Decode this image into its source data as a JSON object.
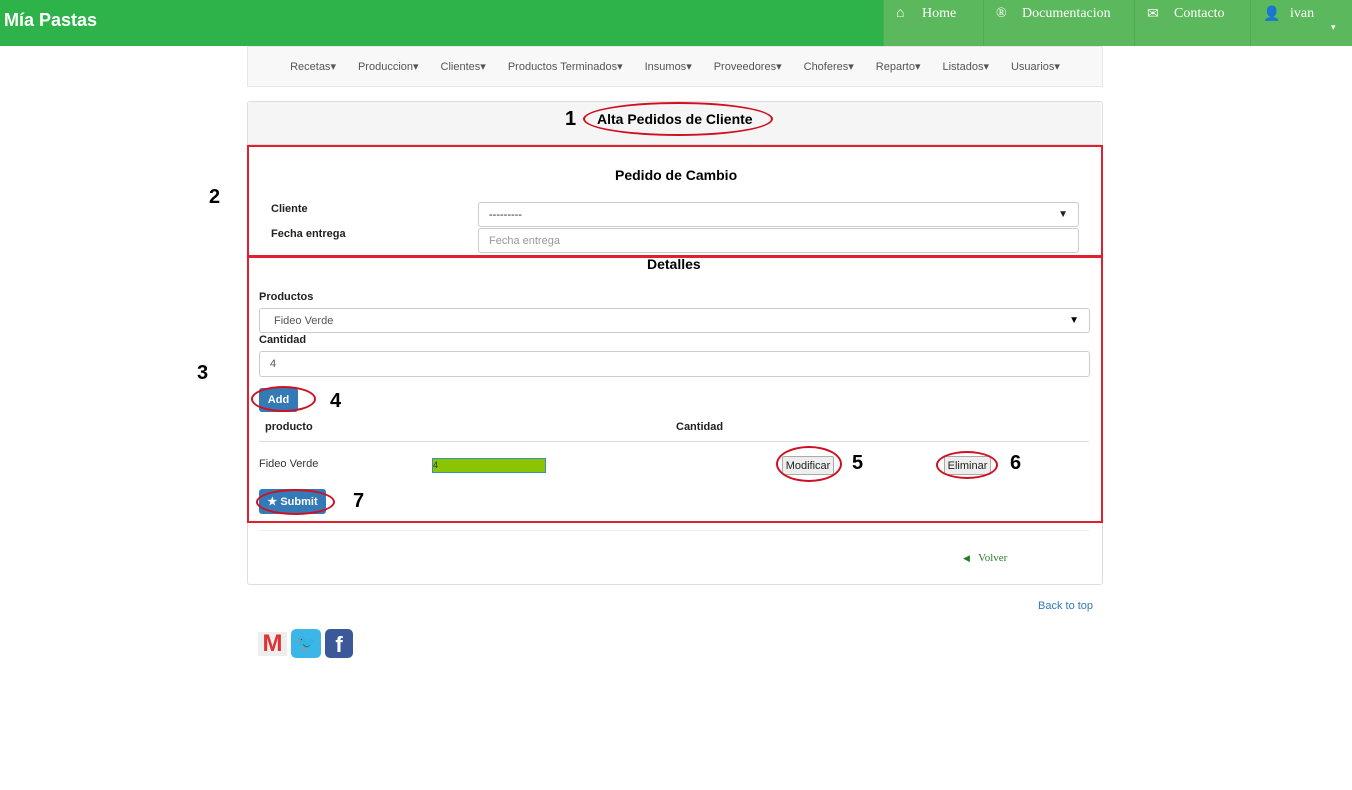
{
  "brand": "Mía Pastas",
  "topnav": {
    "home": "Home",
    "docs": "Documentacion",
    "contact": "Contacto",
    "user": "ivan"
  },
  "menu": [
    "Recetas",
    "Produccion",
    "Clientes",
    "Productos Terminados",
    "Insumos",
    "Proveedores",
    "Choferes",
    "Reparto",
    "Listados",
    "Usuarios"
  ],
  "page_title": "Alta Pedidos de Cliente",
  "section_title": "Pedido de Cambio",
  "form": {
    "cliente_label": "Cliente",
    "cliente_value": "---------",
    "fecha_label": "Fecha entrega",
    "fecha_placeholder": "Fecha entrega"
  },
  "detalles": {
    "title": "Detalles",
    "productos_label": "Productos",
    "productos_value": "Fideo Verde",
    "cantidad_label": "Cantidad",
    "cantidad_value": "4",
    "add": "Add"
  },
  "table": {
    "headers": [
      "producto",
      "Cantidad"
    ],
    "rows": [
      {
        "producto": "Fideo Verde",
        "cantidad": "4",
        "modificar": "Modificar",
        "eliminar": "Eliminar"
      }
    ]
  },
  "submit": "Submit",
  "volver": "Volver",
  "back_to_top": "Back to top",
  "annotations": [
    "1",
    "2",
    "3",
    "4",
    "5",
    "6",
    "7"
  ],
  "colors": {
    "topbar": "#2db34a",
    "nav": "#5cb85c",
    "primary": "#337ab7",
    "annotation": "#e02030"
  }
}
